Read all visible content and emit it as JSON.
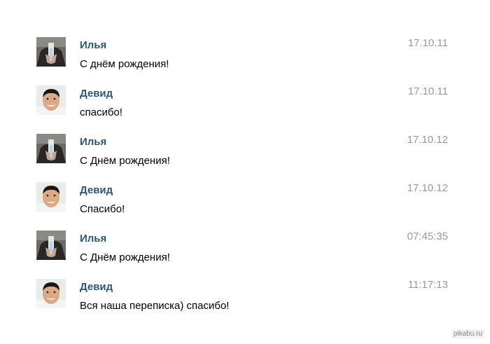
{
  "messages": [
    {
      "author": "Илья",
      "text": "С днём рождения!",
      "time": "17.10.11",
      "avatar": "ilya-avatar"
    },
    {
      "author": "Девид",
      "text": "спасибо!",
      "time": "17.10.11",
      "avatar": "david-avatar"
    },
    {
      "author": "Илья",
      "text": "С Днём рождения!",
      "time": "17.10.12",
      "avatar": "ilya-avatar"
    },
    {
      "author": "Девид",
      "text": "Спасибо!",
      "time": "17.10.12",
      "avatar": "david-avatar"
    },
    {
      "author": "Илья",
      "text": "С Днём рождения!",
      "time": "07:45:35",
      "avatar": "ilya-avatar"
    },
    {
      "author": "Девид",
      "text": "Вся наша переписка) спасибо!",
      "time": "11:17:13",
      "avatar": "david-avatar"
    }
  ],
  "watermark": "pikabu.ru",
  "colors": {
    "author": "#2b587a",
    "text": "#000000",
    "time": "#999999",
    "background": "#ffffff"
  }
}
